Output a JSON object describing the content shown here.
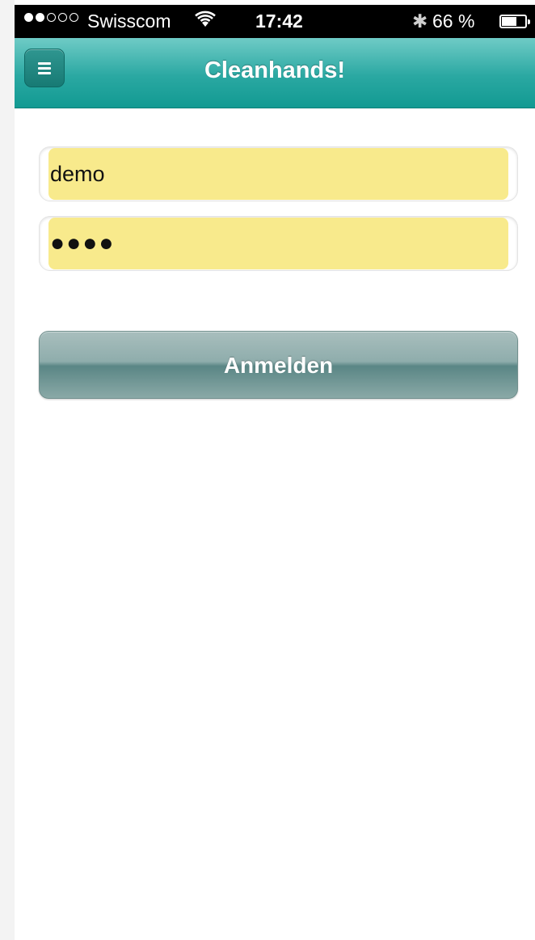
{
  "status_bar": {
    "signal_dots_filled": 2,
    "signal_dots_total": 5,
    "carrier": "Swisscom",
    "wifi_icon": "wifi-icon",
    "time": "17:42",
    "bluetooth_icon": "bluetooth-icon",
    "bluetooth_glyph": "✱",
    "battery_percent": "66 %",
    "battery_level": 0.66
  },
  "nav": {
    "title": "Cleanhands!",
    "menu_icon": "menu-icon"
  },
  "login": {
    "username_value": "demo",
    "password_masked": "●●●●",
    "submit_label": "Anmelden"
  },
  "colors": {
    "nav_teal": "#1ea39b",
    "field_yellow": "#f8ea8c",
    "button_gray_teal": "#8fadac"
  }
}
